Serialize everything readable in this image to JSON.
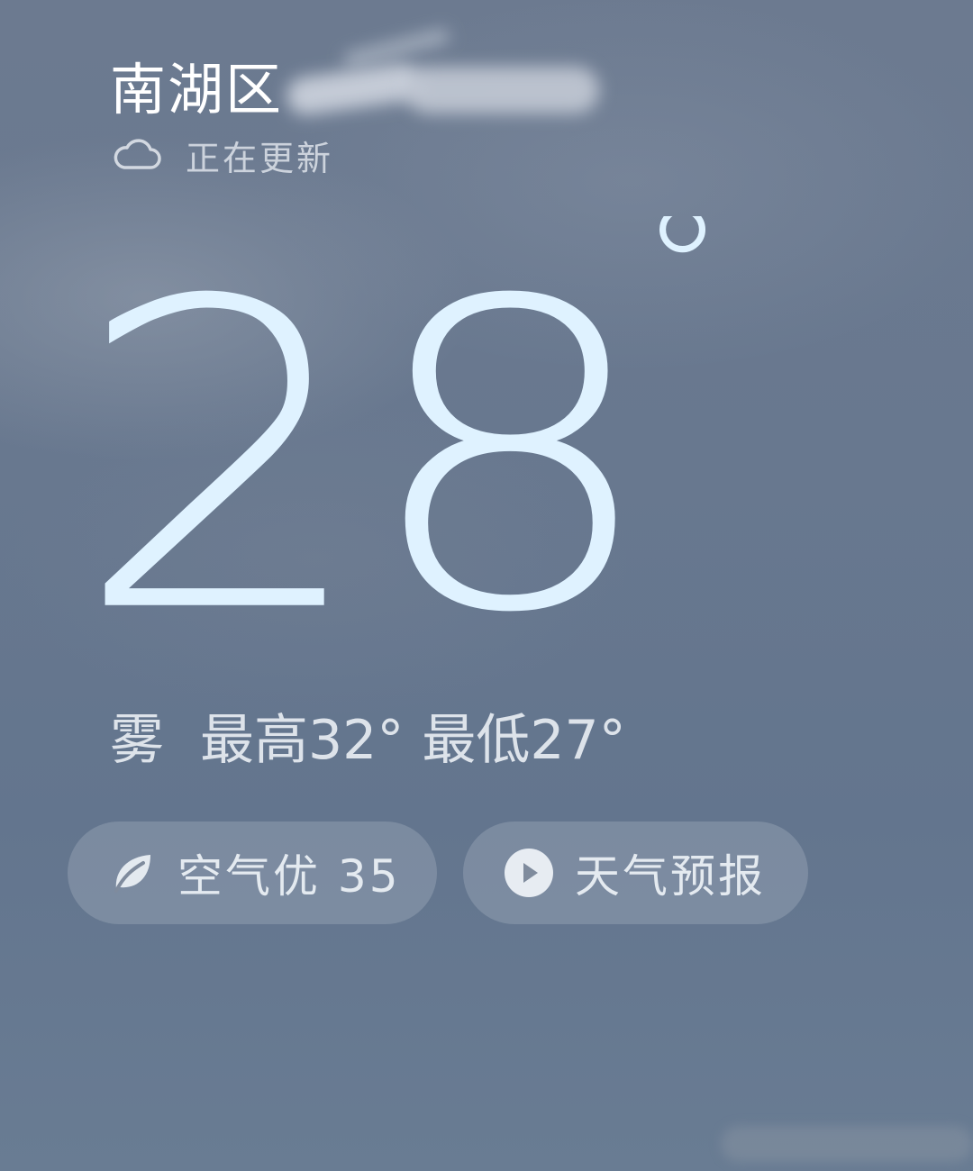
{
  "header": {
    "location": "南湖区",
    "status": "正在更新",
    "status_icon": "cloud-icon"
  },
  "current": {
    "temperature": "28",
    "degree_symbol": "°"
  },
  "summary": {
    "condition": "雾",
    "high": "最高32°",
    "low": "最低27°"
  },
  "actions": {
    "air_quality": {
      "label": "空气优 35",
      "icon": "leaf-icon"
    },
    "forecast": {
      "label": "天气预报",
      "icon": "play-icon"
    }
  },
  "colors": {
    "background": "#68788f",
    "temperature": "#dff2ff",
    "text": "#ffffff",
    "pill": "#8d99aa"
  }
}
